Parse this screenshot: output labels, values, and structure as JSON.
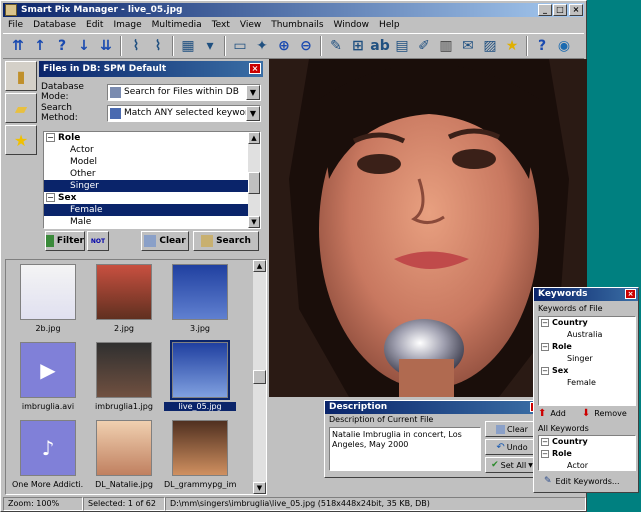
{
  "window": {
    "title": "Smart Pix Manager - live_05.jpg"
  },
  "titlebar_buttons": {
    "minimize": "_",
    "maximize": "□",
    "close": "×"
  },
  "menu": [
    "File",
    "Database",
    "Edit",
    "Image",
    "Multimedia",
    "Text",
    "View",
    "Thumbnails",
    "Window",
    "Help"
  ],
  "toolbar": {
    "icons": [
      "first-icon",
      "up-icon",
      "help-icon",
      "down-icon",
      "last-icon",
      "sep",
      "broom-icon",
      "broom2-icon",
      "sep",
      "grid-icon",
      "dropdown-icon",
      "sep",
      "fit-icon",
      "export-icon",
      "zoom-in-icon",
      "zoom-out-icon",
      "sep",
      "open-icon",
      "stamp-icon",
      "text-icon",
      "folder-icon",
      "edit-icon",
      "delete-icon",
      "mail-icon",
      "image-icon",
      "star-icon",
      "sep",
      "question-icon",
      "globe-icon"
    ],
    "glyphs": {
      "first-icon": "⇈",
      "up-icon": "↑",
      "help-icon": "?",
      "down-icon": "↓",
      "last-icon": "⇊",
      "broom-icon": "⌇",
      "broom2-icon": "⌇",
      "grid-icon": "▦",
      "dropdown-icon": "▾",
      "fit-icon": "▭",
      "export-icon": "✦",
      "zoom-in-icon": "⊕",
      "zoom-out-icon": "⊖",
      "open-icon": "✎",
      "stamp-icon": "⊞",
      "text-icon": "ab",
      "folder-icon": "▤",
      "edit-icon": "✐",
      "delete-icon": "▥",
      "mail-icon": "✉",
      "image-icon": "▨",
      "star-icon": "★",
      "question-icon": "?",
      "globe-icon": "◉"
    }
  },
  "side_tabs": [
    {
      "name": "database-tab",
      "glyph": "▮",
      "color": "#c0902a"
    },
    {
      "name": "folder-tab",
      "glyph": "▰",
      "color": "#e8c040"
    },
    {
      "name": "favorites-tab",
      "glyph": "★",
      "color": "#f0c000"
    }
  ],
  "files_panel": {
    "title": "Files in DB: SPM Default",
    "database_mode_label": "Database Mode:",
    "database_mode_value": "Search for Files within DB",
    "search_method_label": "Search Method:",
    "search_method_value": "Match ANY selected keywords",
    "tree": [
      {
        "type": "group",
        "label": "Role"
      },
      {
        "type": "leaf",
        "label": "Actor",
        "selected": false
      },
      {
        "type": "leaf",
        "label": "Model",
        "selected": false
      },
      {
        "type": "leaf",
        "label": "Other",
        "selected": false
      },
      {
        "type": "leaf",
        "label": "Singer",
        "selected": true
      },
      {
        "type": "group",
        "label": "Sex"
      },
      {
        "type": "leaf",
        "label": "Female",
        "selected": true
      },
      {
        "type": "leaf",
        "label": "Male",
        "selected": false
      }
    ],
    "filter_label": "Filter",
    "not_label": "NOT",
    "clear_label": "Clear",
    "search_label": "Search"
  },
  "thumbnails": [
    {
      "label": "2b.jpg",
      "kind": "photo-girl"
    },
    {
      "label": "2.jpg",
      "kind": "photo-group"
    },
    {
      "label": "3.jpg",
      "kind": "photo-blue"
    },
    {
      "label": "imbruglia.avi",
      "kind": "video"
    },
    {
      "label": "imbruglia1.jpg",
      "kind": "photo-dark"
    },
    {
      "label": "live_05.jpg",
      "kind": "photo-blue2",
      "selected": true
    },
    {
      "label": "One More Addicti...",
      "kind": "audio"
    },
    {
      "label": "DL_Natalie.jpg",
      "kind": "photo-face"
    },
    {
      "label": "DL_grammypg_im...",
      "kind": "photo-face2"
    }
  ],
  "status": {
    "zoom": "Zoom: 100%",
    "selected": "Selected: 1 of 62",
    "path": "D:\\mm\\singers\\imbruglia\\live_05.jpg  (518x448x24bit, 35 KB, DB)"
  },
  "keywords_panel": {
    "title": "Keywords",
    "keywords_of_file_label": "Keywords of File",
    "file_tree": [
      {
        "type": "group",
        "label": "Country"
      },
      {
        "type": "leaf",
        "label": "Australia"
      },
      {
        "type": "group",
        "label": "Role"
      },
      {
        "type": "leaf",
        "label": "Singer"
      },
      {
        "type": "group",
        "label": "Sex"
      },
      {
        "type": "leaf",
        "label": "Female"
      }
    ],
    "add_label": "Add",
    "remove_label": "Remove",
    "all_keywords_label": "All Keywords",
    "all_tree": [
      {
        "type": "group",
        "label": "Country"
      },
      {
        "type": "group",
        "label": "Role"
      },
      {
        "type": "leaf",
        "label": "Actor"
      }
    ],
    "edit_label": "Edit Keywords..."
  },
  "description_panel": {
    "title": "Description",
    "subtitle": "Description of Current File",
    "text": "Natalie Imbruglia in concert, Los Angeles, May 2000",
    "clear_label": "Clear",
    "undo_label": "Undo",
    "setall_label": "Set All"
  },
  "colors": {
    "title_dark": "#0a246a",
    "title_light": "#a6caf0",
    "desktop": "#008080",
    "selection": "#0a246a"
  }
}
